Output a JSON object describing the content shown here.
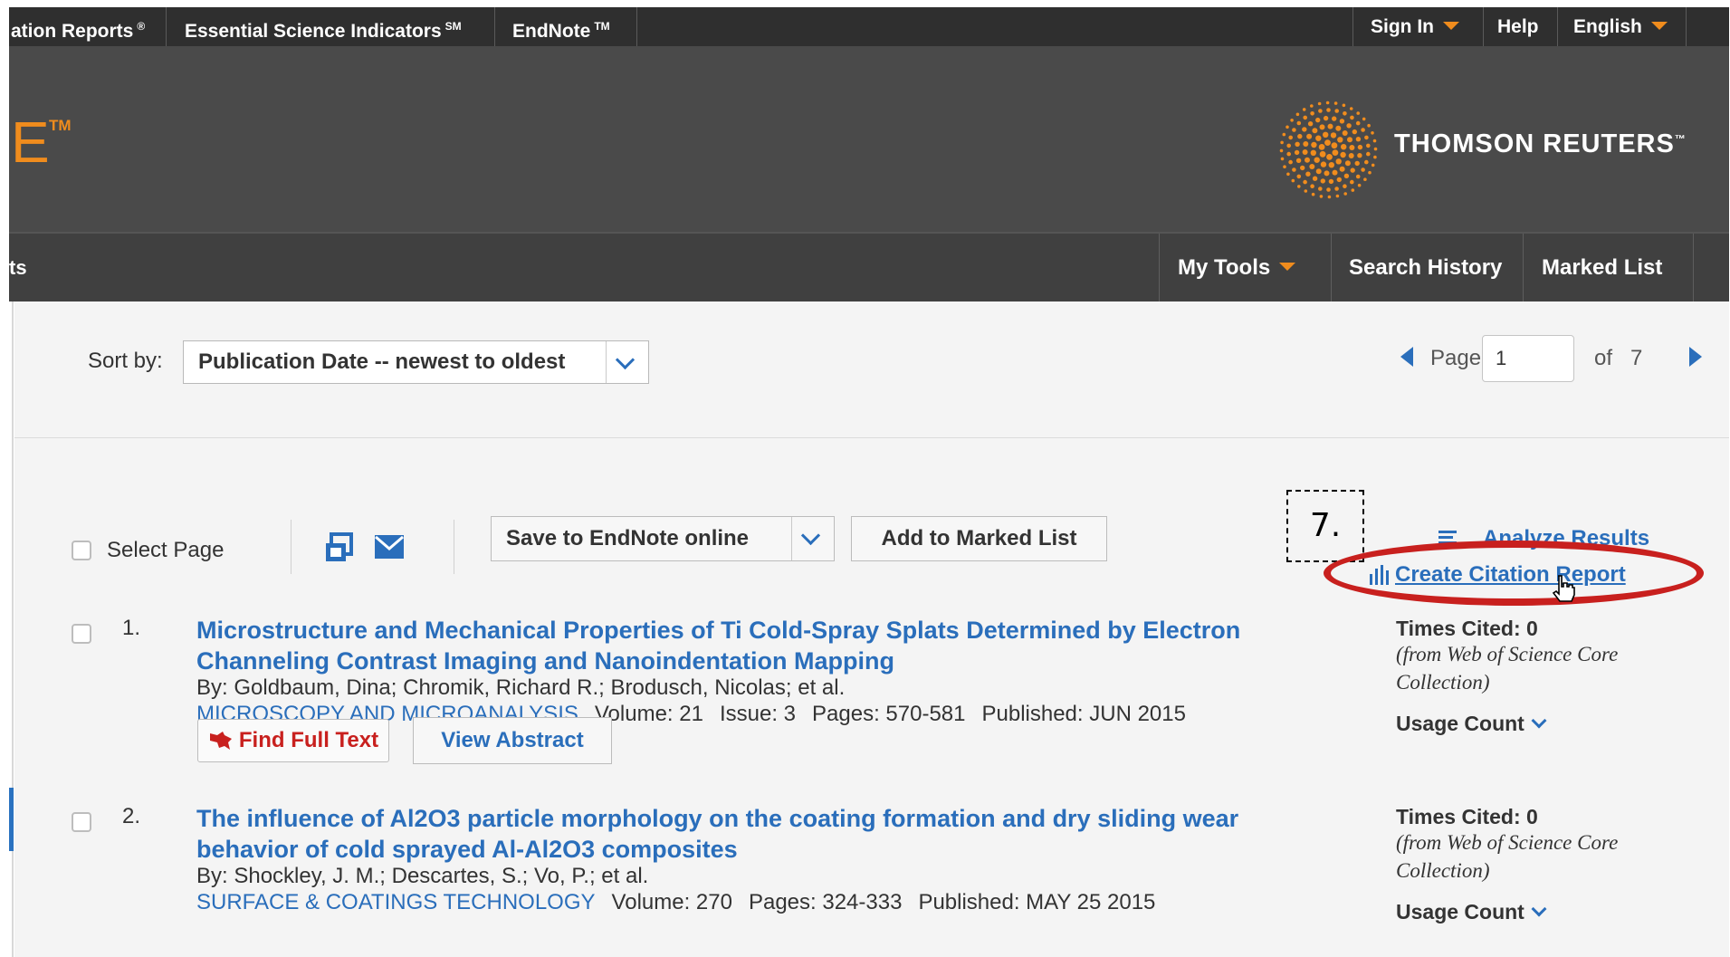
{
  "topbar": {
    "products": [
      {
        "label": "ation Reports",
        "mark": "®"
      },
      {
        "label": "Essential Science Indicators",
        "mark": "SM"
      },
      {
        "label": "EndNote",
        "mark": "TM"
      }
    ],
    "sign_in": "Sign In",
    "help": "Help",
    "language": "English"
  },
  "header": {
    "logo_partial": "E",
    "logo_tm": "TM",
    "brand": "THOMSON REUTERS",
    "brand_tm": "™"
  },
  "nav": {
    "partial_left": "ts",
    "items": [
      "My Tools",
      "Search History",
      "Marked List"
    ]
  },
  "sort": {
    "label": "Sort by:",
    "selected": "Publication Date -- newest to oldest"
  },
  "pager": {
    "page_label": "Page",
    "page_value": "1",
    "of_label": "of",
    "total": "7"
  },
  "toolbar": {
    "select_page": "Select Page",
    "save_endnote": "Save to EndNote online",
    "add_marked": "Add to Marked List",
    "analyze": "Analyze Results",
    "citation_report": "Create Citation Report",
    "annotation": "7."
  },
  "records": [
    {
      "num": "1.",
      "title": "Microstructure and Mechanical Properties of Ti Cold-Spray Splats Determined by Electron Channeling Contrast Imaging and Nanoindentation Mapping",
      "authors": "By: Goldbaum, Dina; Chromik, Richard R.; Brodusch, Nicolas; et al.",
      "journal": "MICROSCOPY AND MICROANALYSIS",
      "volume": "Volume: 21",
      "issue": "Issue: 3",
      "pages": "Pages: 570-581",
      "published": "Published: JUN 2015",
      "find_full_text": "Find Full Text",
      "view_abstract": "View Abstract",
      "times_cited": "Times Cited: 0",
      "cited_source": "(from Web of Science Core Collection)",
      "usage_count": "Usage Count"
    },
    {
      "num": "2.",
      "title": "The influence of Al2O3 particle morphology on the coating formation and dry sliding wear behavior of cold sprayed Al-Al2O3 composites",
      "authors": "By: Shockley, J. M.; Descartes, S.; Vo, P.; et al.",
      "journal": "SURFACE & COATINGS TECHNOLOGY",
      "volume": "Volume: 270",
      "pages": "Pages: 324-333",
      "published": "Published: MAY 25 2015",
      "times_cited": "Times Cited: 0",
      "cited_source": "(from Web of Science Core Collection)",
      "usage_count": "Usage Count"
    }
  ],
  "colors": {
    "link": "#2a6ebb",
    "accent": "#f08c1d",
    "highlight": "#c8201e"
  }
}
